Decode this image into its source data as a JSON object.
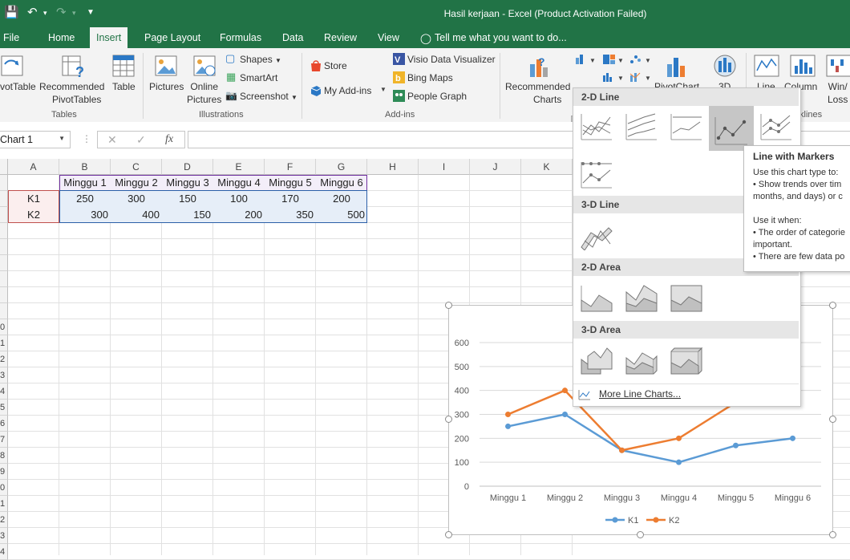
{
  "app": {
    "window_title": "Hasil kerjaan - Excel (Product Activation Failed)",
    "accent_color": "#217346"
  },
  "tabs": [
    {
      "label": "File"
    },
    {
      "label": "Home"
    },
    {
      "label": "Insert",
      "active": true
    },
    {
      "label": "Page Layout"
    },
    {
      "label": "Formulas"
    },
    {
      "label": "Data"
    },
    {
      "label": "Review"
    },
    {
      "label": "View"
    }
  ],
  "tell_me": "Tell me what you want to do...",
  "ribbon": {
    "tables": {
      "pivottable": "votTable",
      "recommended_pivot_1": "Recommended",
      "recommended_pivot_2": "PivotTables",
      "table": "Table",
      "group": "Tables"
    },
    "illustrations": {
      "pictures": "Pictures",
      "online_1": "Online",
      "online_2": "Pictures",
      "shapes": "Shapes",
      "smartart": "SmartArt",
      "screenshot": "Screenshot",
      "group": "Illustrations"
    },
    "addins": {
      "store": "Store",
      "my_addins": "My Add-ins",
      "visio": "Visio Data Visualizer",
      "bing": "Bing Maps",
      "people": "People Graph",
      "group": "Add-ins"
    },
    "charts": {
      "recommended_1": "Recommended",
      "recommended_2": "Charts",
      "pivotchart": "PivotChart",
      "threed": "3D",
      "line": "Line",
      "column": "Column",
      "winloss_1": "Win/",
      "winloss_2": "Loss",
      "sparklines": "klines"
    }
  },
  "formula_bar": {
    "name_box": "Chart 1",
    "fx": "fx",
    "formula": ""
  },
  "grid": {
    "columns": [
      "A",
      "B",
      "C",
      "D",
      "E",
      "F",
      "G",
      "H",
      "I",
      "J",
      "K"
    ],
    "rows": [
      "",
      "",
      "",
      "",
      "",
      "",
      "",
      "",
      "",
      "0",
      "1",
      "2",
      "3",
      "4",
      "5",
      "6",
      "7",
      "8",
      "9",
      "0",
      "1",
      "2",
      "3",
      "4"
    ],
    "header_row": [
      "Minggu 1",
      "Minggu 2",
      "Minggu 3",
      "Minggu 4",
      "Minggu 5",
      "Minggu 6"
    ],
    "data_rows": [
      {
        "label": "K1",
        "values": [
          "250",
          "300",
          "150",
          "100",
          "170",
          "200"
        ]
      },
      {
        "label": "K2",
        "values": [
          "300",
          "400",
          "150",
          "200",
          "350",
          "500"
        ]
      }
    ]
  },
  "dropdown": {
    "sections": [
      {
        "title": "2-D Line"
      },
      {
        "title": "3-D Line"
      },
      {
        "title": "2-D Area"
      },
      {
        "title": "3-D Area"
      }
    ],
    "more": "More Line Charts..."
  },
  "tooltip": {
    "title": "Line with Markers",
    "lines": [
      "Use this chart type to:",
      "• Show trends over tim",
      "months, and days) or c",
      "",
      "Use it when:",
      "• The order of categorie",
      "important.",
      "• There are few data po"
    ]
  },
  "chart_data": {
    "type": "line",
    "categories": [
      "Minggu 1",
      "Minggu 2",
      "Minggu 3",
      "Minggu 4",
      "Minggu 5",
      "Minggu 6"
    ],
    "series": [
      {
        "name": "K1",
        "values": [
          250,
          300,
          150,
          100,
          170,
          200
        ],
        "color": "#5b9bd5"
      },
      {
        "name": "K2",
        "values": [
          300,
          400,
          150,
          200,
          350,
          500
        ],
        "color": "#ed7d31"
      }
    ],
    "yticks": [
      "0",
      "100",
      "200",
      "300",
      "400",
      "500",
      "600"
    ],
    "ylim": [
      0,
      600
    ],
    "legend": "bottom",
    "grid": true
  }
}
